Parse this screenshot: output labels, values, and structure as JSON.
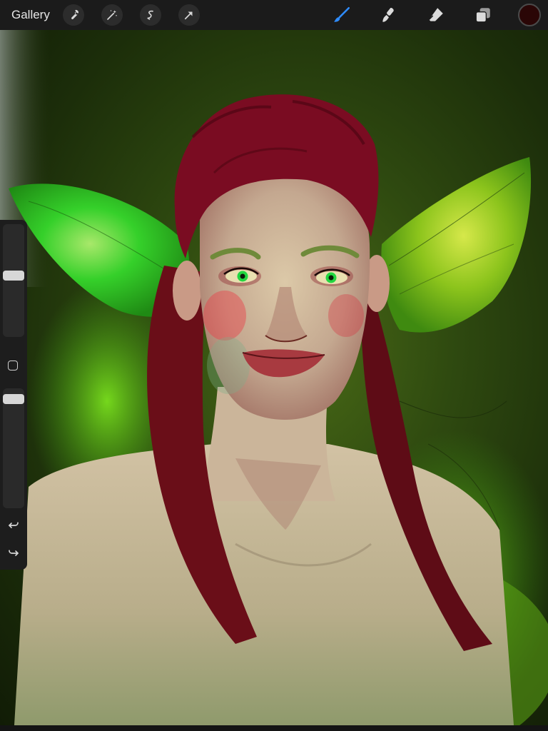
{
  "toolbar": {
    "gallery_label": "Gallery",
    "left_tools": [
      "wrench-icon",
      "magic-wand-icon",
      "selection-icon",
      "transform-arrow-icon"
    ],
    "right_tools": [
      "brush-icon",
      "smudge-icon",
      "eraser-icon",
      "layers-icon"
    ],
    "active_tool": "brush-icon",
    "active_tool_color": "#2f8cff",
    "current_color": "#2a0606"
  },
  "sidebar": {
    "brush_size_level": 0.55,
    "opacity_level": 0.95
  }
}
